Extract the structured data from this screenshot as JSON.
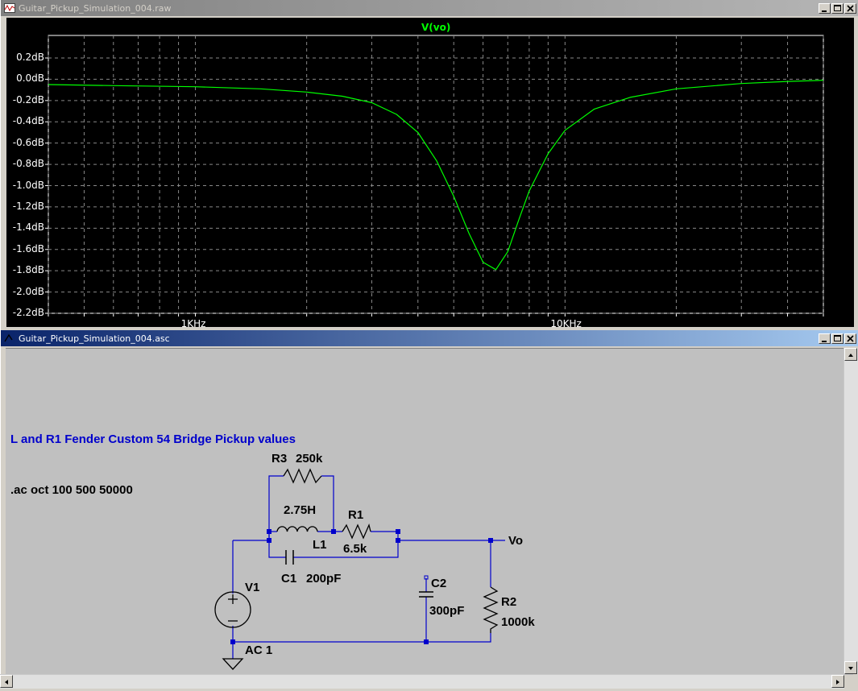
{
  "plot_window": {
    "title": "Guitar_Pickup_Simulation_004.raw",
    "trace_name": "V(vo)",
    "y_ticks": [
      "0.2dB",
      "0.0dB",
      "-0.2dB",
      "-0.4dB",
      "-0.6dB",
      "-0.8dB",
      "-1.0dB",
      "-1.2dB",
      "-1.4dB",
      "-1.6dB",
      "-1.8dB",
      "-2.0dB",
      "-2.2dB"
    ],
    "x_ticks": [
      "1KHz",
      "10KHz"
    ],
    "trace_color": "#00ff00"
  },
  "chart_data": {
    "type": "line",
    "title": "",
    "xlabel": "",
    "ylabel": "",
    "x_scale": "log",
    "xlim": [
      400,
      50000
    ],
    "ylim": [
      -2.2,
      0.3
    ],
    "grid": true,
    "series": [
      {
        "name": "V(vo)",
        "x": [
          400,
          600,
          1000,
          1500,
          2000,
          2500,
          3000,
          3500,
          4000,
          4500,
          5000,
          5500,
          6000,
          6500,
          7000,
          7500,
          8000,
          9000,
          10000,
          12000,
          15000,
          20000,
          30000,
          40000,
          50000
        ],
        "y": [
          -0.05,
          -0.06,
          -0.07,
          -0.09,
          -0.12,
          -0.16,
          -0.22,
          -0.33,
          -0.5,
          -0.77,
          -1.1,
          -1.45,
          -1.72,
          -1.79,
          -1.62,
          -1.32,
          -1.05,
          -0.7,
          -0.48,
          -0.28,
          -0.17,
          -0.09,
          -0.04,
          -0.02,
          -0.01
        ]
      }
    ]
  },
  "schematic_window": {
    "title": "Guitar_Pickup_Simulation_004.asc",
    "comment": "L and R1 Fender Custom 54 Bridge Pickup values",
    "directive": ".ac oct 100 500 50000",
    "components": {
      "r3_name": "R3",
      "r3_value": "250k",
      "l1_value": "2.75H",
      "l1_name": "L1",
      "r1_name": "R1",
      "r1_value": "6.5k",
      "c1_name": "C1",
      "c1_value": "200pF",
      "v1_name": "V1",
      "v1_value": "AC 1",
      "c2_name": "C2",
      "c2_value": "300pF",
      "r2_name": "R2",
      "r2_value": "1000k",
      "net_vo": "Vo"
    },
    "wire_color": "#0000cc",
    "comment_color": "#0000cc"
  }
}
